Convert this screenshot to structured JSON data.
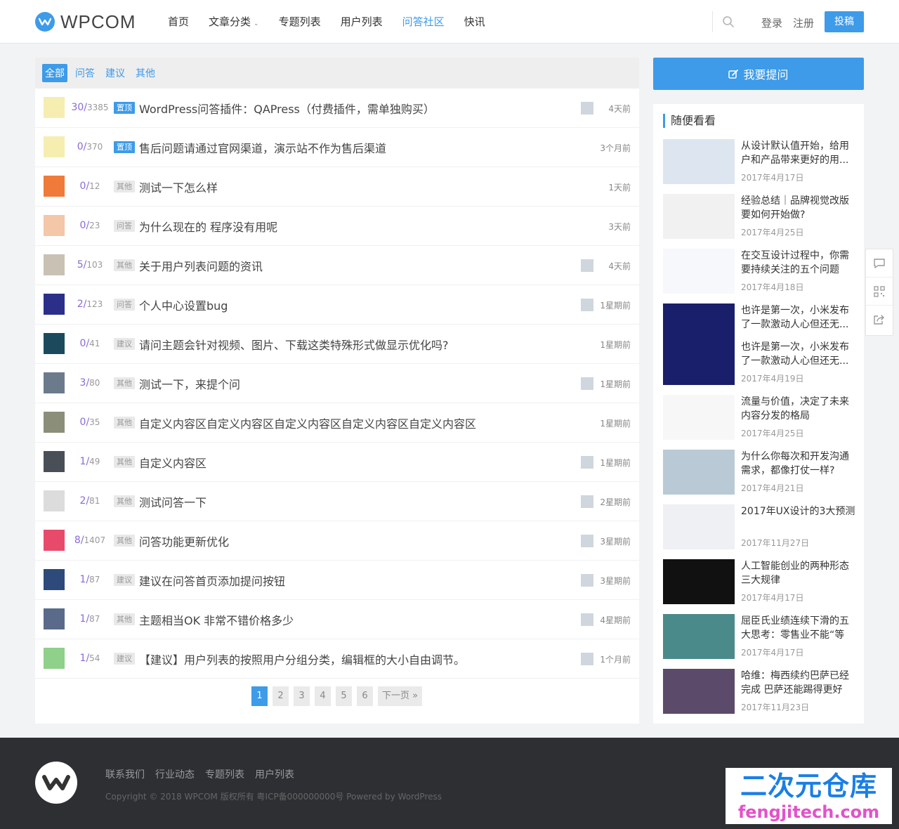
{
  "header": {
    "logo_text": "WPCOM",
    "nav": [
      {
        "label": "首页",
        "active": false,
        "dropdown": false
      },
      {
        "label": "文章分类",
        "active": false,
        "dropdown": true
      },
      {
        "label": "专题列表",
        "active": false,
        "dropdown": false
      },
      {
        "label": "用户列表",
        "active": false,
        "dropdown": false
      },
      {
        "label": "问答社区",
        "active": true,
        "dropdown": false
      },
      {
        "label": "快讯",
        "active": false,
        "dropdown": false
      }
    ],
    "login": "登录",
    "register": "注册",
    "post_button": "投稿"
  },
  "qa": {
    "tabs": [
      {
        "label": "全部",
        "active": true
      },
      {
        "label": "问答",
        "active": false
      },
      {
        "label": "建议",
        "active": false
      },
      {
        "label": "其他",
        "active": false
      }
    ],
    "rows": [
      {
        "answers": "30",
        "views": "3385",
        "tag": "置顶",
        "pinned": true,
        "title": "WordPress问答插件：QAPress（付费插件，需单独购买）",
        "time": "4天前",
        "avatar_color": "#f6eeb0",
        "reply_avatar": true
      },
      {
        "answers": "0",
        "views": "370",
        "tag": "置顶",
        "pinned": true,
        "title": "售后问题请通过官网渠道，演示站不作为售后渠道",
        "time": "3个月前",
        "avatar_color": "#f6eeb0",
        "reply_avatar": false
      },
      {
        "answers": "0",
        "views": "12",
        "tag": "其他",
        "pinned": false,
        "title": "测试一下怎么样",
        "time": "1天前",
        "avatar_color": "#f07a3a",
        "reply_avatar": false
      },
      {
        "answers": "0",
        "views": "23",
        "tag": "问答",
        "pinned": false,
        "title": "为什么现在的 程序没有用呢",
        "time": "3天前",
        "avatar_color": "#f3c7a8",
        "reply_avatar": false
      },
      {
        "answers": "5",
        "views": "103",
        "tag": "其他",
        "pinned": false,
        "title": "关于用户列表问题的资讯",
        "time": "4天前",
        "avatar_color": "#c9c2b4",
        "reply_avatar": true
      },
      {
        "answers": "2",
        "views": "123",
        "tag": "问答",
        "pinned": false,
        "title": "个人中心设置bug",
        "time": "1星期前",
        "avatar_color": "#2b2f8a",
        "reply_avatar": true
      },
      {
        "answers": "0",
        "views": "41",
        "tag": "建议",
        "pinned": false,
        "title": "请问主题会针对视频、图片、下载这类特殊形式做显示优化吗?",
        "time": "1星期前",
        "avatar_color": "#1c4a5c",
        "reply_avatar": false
      },
      {
        "answers": "3",
        "views": "80",
        "tag": "其他",
        "pinned": false,
        "title": "测试一下，来提个问",
        "time": "1星期前",
        "avatar_color": "#6b7b8c",
        "reply_avatar": true
      },
      {
        "answers": "0",
        "views": "35",
        "tag": "其他",
        "pinned": false,
        "title": "自定义内容区自定义内容区自定义内容区自定义内容区自定义内容区",
        "time": "1星期前",
        "avatar_color": "#8b8f7a",
        "reply_avatar": false
      },
      {
        "answers": "1",
        "views": "49",
        "tag": "其他",
        "pinned": false,
        "title": "自定义内容区",
        "time": "1星期前",
        "avatar_color": "#4a4f57",
        "reply_avatar": true
      },
      {
        "answers": "2",
        "views": "81",
        "tag": "其他",
        "pinned": false,
        "title": "测试问答一下",
        "time": "2星期前",
        "avatar_color": "#dcdcdc",
        "reply_avatar": true
      },
      {
        "answers": "8",
        "views": "1407",
        "tag": "其他",
        "pinned": false,
        "title": "问答功能更新优化",
        "time": "3星期前",
        "avatar_color": "#e84a6b",
        "reply_avatar": true
      },
      {
        "answers": "1",
        "views": "87",
        "tag": "建议",
        "pinned": false,
        "title": "建议在问答首页添加提问按钮",
        "time": "3星期前",
        "avatar_color": "#2d4a7a",
        "reply_avatar": true
      },
      {
        "answers": "1",
        "views": "87",
        "tag": "其他",
        "pinned": false,
        "title": "主题相当OK 非常不错价格多少",
        "time": "4星期前",
        "avatar_color": "#5a6a8a",
        "reply_avatar": true
      },
      {
        "answers": "1",
        "views": "54",
        "tag": "建议",
        "pinned": false,
        "title": "【建议】用户列表的按照用户分组分类，编辑框的大小自由调节。",
        "time": "1个月前",
        "avatar_color": "#8fd08a",
        "reply_avatar": true
      }
    ],
    "pagination": {
      "pages": [
        "1",
        "2",
        "3",
        "4",
        "5",
        "6"
      ],
      "current": "1",
      "next": "下一页 »"
    }
  },
  "sidebar": {
    "ask_button": "我要提问",
    "heading": "随便看看",
    "articles": [
      {
        "title": "从设计默认值开始，给用户和产品带来更好的用...",
        "date": "2017年4月17日",
        "thumb_color": "#dde6f0"
      },
      {
        "title": "经验总结｜品牌视觉改版要如何开始做?",
        "date": "2017年4月25日",
        "thumb_color": "#f1f1f1"
      },
      {
        "title": "在交互设计过程中，你需要持续关注的五个问题",
        "date": "2017年4月18日",
        "thumb_color": "#f6f8fb"
      },
      {
        "title": "也许是第一次，小米发布了一款激动人心但还无...",
        "date": "",
        "thumb_color": "#1a1f6b"
      },
      {
        "title": "也许是第一次，小米发布了一款激动人心但还无...",
        "date": "2017年4月19日",
        "thumb_color": "#1a1f6b"
      },
      {
        "title": "流量与价值，决定了未来内容分发的格局",
        "date": "2017年4月25日",
        "thumb_color": "#f7f7f7"
      },
      {
        "title": "为什么你每次和开发沟通需求，都像打仗一样?",
        "date": "2017年4月21日",
        "thumb_color": "#b9cad6"
      },
      {
        "title": "2017年UX设计的3大预测",
        "date": "2017年11月27日",
        "thumb_color": "#eef0f3"
      },
      {
        "title": "人工智能创业的两种形态三大规律",
        "date": "2017年4月17日",
        "thumb_color": "#111111"
      },
      {
        "title": "屈臣氏业绩连续下滑的五大思考：零售业不能“等",
        "date": "2017年4月17日",
        "thumb_color": "#4a8a8a"
      },
      {
        "title": "哈维：梅西续约巴萨已经完成 巴萨还能踢得更好",
        "date": "2017年11月23日",
        "thumb_color": "#5c4a6a"
      }
    ]
  },
  "footer": {
    "links": [
      "联系我们",
      "行业动态",
      "专题列表",
      "用户列表"
    ],
    "copyright": "Copyright © 2018 WPCOM 版权所有 粤ICP备000000000号 Powered by WordPress"
  },
  "watermark": {
    "line1": "二次元仓库",
    "line2": "fengjitech.com"
  },
  "colors": {
    "accent": "#3d9be9",
    "answers": "#8a6bd6",
    "footer_bg": "#2d2f33"
  }
}
